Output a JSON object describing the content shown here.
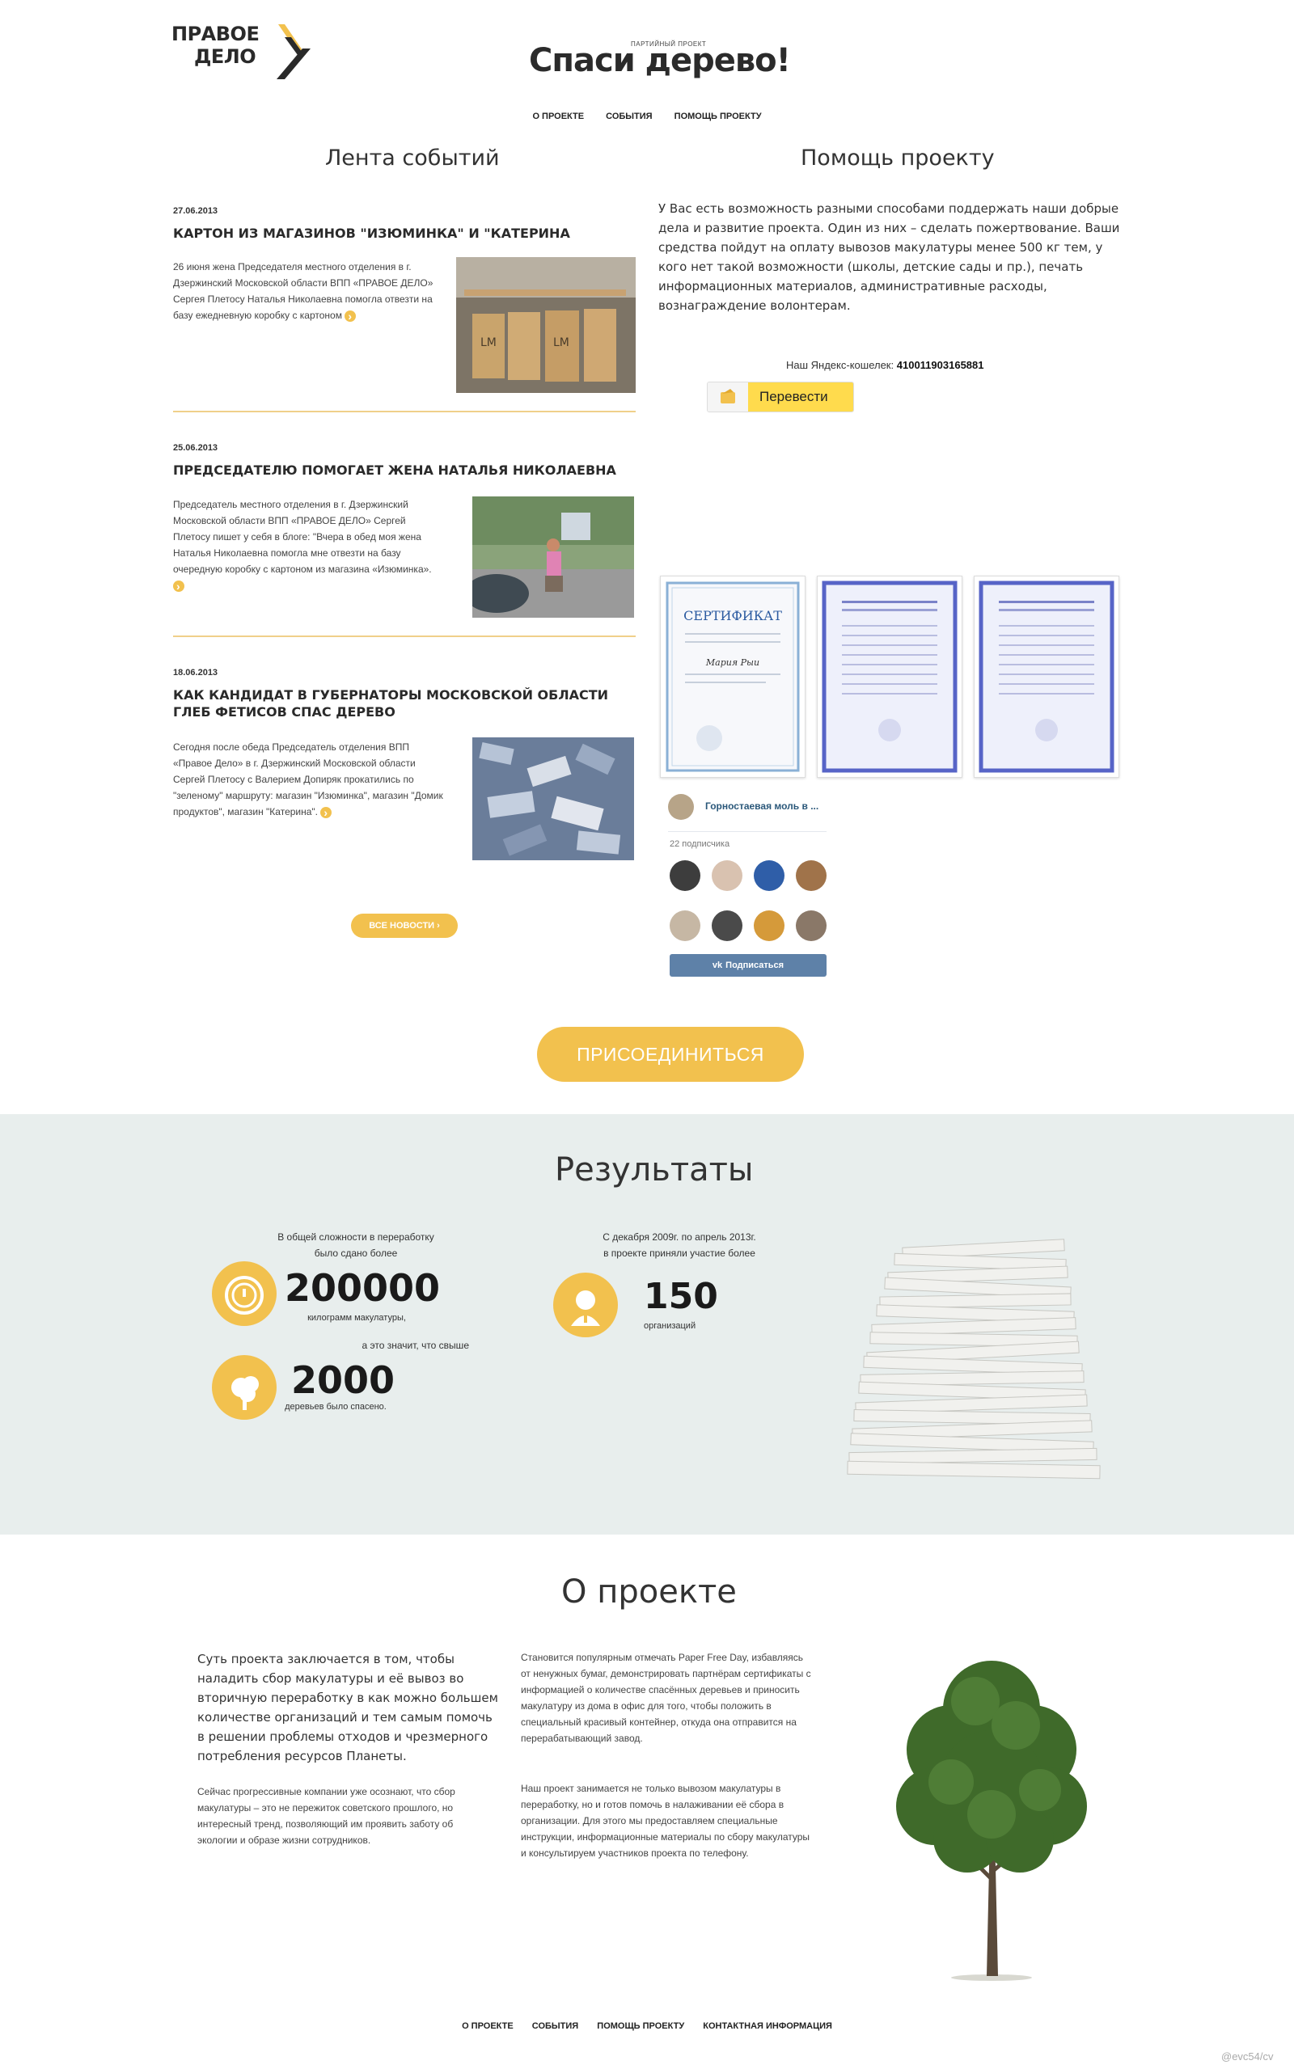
{
  "header": {
    "logo_line1": "ПРАВОЕ",
    "logo_line2": "ДЕЛО",
    "party_label": "ПАРТИЙНЫЙ ПРОЕКТ",
    "title": "Спаси дерево!"
  },
  "nav": {
    "items": [
      "О ПРОЕКТЕ",
      "СОБЫТИЯ",
      "ПОМОЩЬ ПРОЕКТУ"
    ]
  },
  "news": {
    "heading": "Лента событий",
    "items": [
      {
        "date": "27.06.2013",
        "title": "КАРТОН ИЗ МАГАЗИНОВ \"ИЗЮМИНКА\" И \"КАТЕРИНА",
        "text": "26 июня жена Председателя местного отделения в г. Дзержинский Московской области ВПП «ПРАВОЕ ДЕЛО» Сергея Плетосу Наталья Николаевна помогла отвезти на базу ежедневную коробку с картоном"
      },
      {
        "date": "25.06.2013",
        "title": "ПРЕДСЕДАТЕЛЮ ПОМОГАЕТ ЖЕНА НАТАЛЬЯ НИКОЛАЕВНА",
        "text": "Председатель местного отделения в г. Дзержинский Московской области ВПП «ПРАВОЕ ДЕЛО» Сергей Плетосу пишет у себя в блоге: \"Вчера в обед моя жена Наталья Николаевна помогла мне отвезти на базу очередную коробку с картоном из магазина «Изюминка»."
      },
      {
        "date": "18.06.2013",
        "title": "КАК КАНДИДАТ В ГУБЕРНАТОРЫ МОСКОВСКОЙ ОБЛАСТИ ГЛЕБ ФЕТИСОВ СПАС ДЕРЕВО",
        "text": "Сегодня после обеда Председатель отделения ВПП «Правое Дело» в г. Дзержинский Московской области Сергей Плетосу с Валерием Допиряк прокатились по \"зеленому\" маршруту: магазин \"Изюминка\", магазин \"Домик продуктов\", магазин \"Катерина\"."
      }
    ],
    "all_button": "ВСЕ НОВОСТИ ›"
  },
  "help": {
    "heading": "Помощь проекту",
    "text": "У Вас есть возможность разными способами поддержать наши добрые дела и развитие проекта. Один из них – сделать пожертвование. Ваши средства пойдут на оплату вывозов макулатуры менее 500 кг тем, у кого нет такой возможности (школы, детские сады и пр.), печать информационных материалов, административные расходы, вознаграждение волонтерам.",
    "wallet_label": "Наш Яндекс-кошелек:",
    "wallet_number": "410011903165881",
    "transfer_button": "Перевести",
    "cert1_title": "СЕРТИФИКАТ",
    "cert1_name": "Мария Рыи"
  },
  "vk": {
    "group_name": "Горностаевая моль в ...",
    "subscribers": "22 подписчика",
    "subscribe_button": "Подписаться"
  },
  "join_button": "ПРИСОЕДИНИТЬСЯ",
  "results": {
    "heading": "Результаты",
    "stat1_pre": "В общей сложности в переработку\nбыло сдано более",
    "stat1_value": "200000",
    "stat1_unit": "килограмм макулатуры,",
    "stat2_pre": "а это значит, что свыше",
    "stat2_value": "2000",
    "stat2_unit": "деревьев было спасено.",
    "stat3_pre": "С декабря 2009г. по апрель 2013г.\nв проекте приняли участие более",
    "stat3_value": "150",
    "stat3_unit": "организаций"
  },
  "about": {
    "heading": "О проекте",
    "lead": "Суть проекта заключается в том, чтобы наладить сбор макулатуры и её вывоз во вторичную переработку в как можно большем количестве организаций и тем самым помочь в решении проблемы отходов и чрезмерного потребления ресурсов Планеты.",
    "p1": "Сейчас прогрессивные компании уже осознают, что сбор макулатуры – это не пережиток советского прошлого, но интересный тренд, позволяющий им проявить заботу об экологии и образе жизни сотрудников.",
    "p2": "Становится популярным отмечать Paper Free Day, избавляясь от ненужных бумаг, демонстрировать партнёрам сертификаты с информацией о количестве спасённых деревьев и приносить макулатуру из дома в офис для того, чтобы положить в специальный красивый контейнер, откуда она отправится на перерабатывающий завод.",
    "p3": "Наш проект занимается не только вывозом макулатуры в переработку, но и готов помочь в налаживании её сбора в организации. Для этого мы предоставляем специальные инструкции, информационные материалы по сбору макулатуры и консультируем участников проекта по телефону."
  },
  "footer": {
    "items": [
      "О ПРОЕКТЕ",
      "СОБЫТИЯ",
      "ПОМОЩЬ ПРОЕКТУ",
      "КОНТАКТНАЯ ИНФОРМАЦИЯ"
    ],
    "watermark": "@evc54/cv"
  },
  "colors": {
    "accent": "#f2c14e",
    "results_bg": "#e8eeed",
    "vk": "#5e81a8",
    "yandex": "#ffdb4d"
  }
}
